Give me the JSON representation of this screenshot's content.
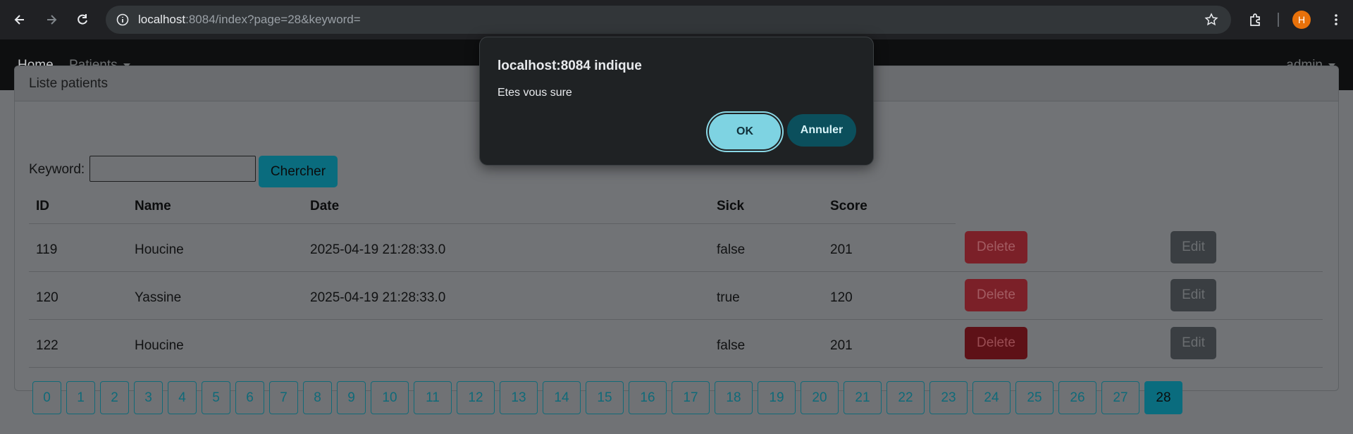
{
  "browser": {
    "url_host": "localhost",
    "url_rest": ":8084/index?page=28&keyword=",
    "profile_initial": "H"
  },
  "navbar": {
    "home": "Home",
    "patients": "Patients",
    "user": "admin"
  },
  "card": {
    "title": "Liste patients",
    "search_label": "Keyword:",
    "search_value": "",
    "search_button": "Chercher"
  },
  "table": {
    "headers": [
      "ID",
      "Name",
      "Date",
      "Sick",
      "Score"
    ],
    "rows": [
      {
        "id": "119",
        "name": "Houcine",
        "date": "2025-04-19 21:28:33.0",
        "sick": "false",
        "score": "201",
        "delete": "Delete",
        "edit": "Edit"
      },
      {
        "id": "120",
        "name": "Yassine",
        "date": "2025-04-19 21:28:33.0",
        "sick": "true",
        "score": "120",
        "delete": "Delete",
        "edit": "Edit"
      },
      {
        "id": "122",
        "name": "Houcine",
        "date": "",
        "sick": "false",
        "score": "201",
        "delete": "Delete",
        "edit": "Edit"
      }
    ]
  },
  "pagination": {
    "pages": [
      "0",
      "1",
      "2",
      "3",
      "4",
      "5",
      "6",
      "7",
      "8",
      "9",
      "10",
      "11",
      "12",
      "13",
      "14",
      "15",
      "16",
      "17",
      "18",
      "19",
      "20",
      "21",
      "22",
      "23",
      "24",
      "25",
      "26",
      "27",
      "28"
    ],
    "active": "28"
  },
  "dialog": {
    "title": "localhost:8084 indique",
    "message": "Etes vous sure",
    "ok": "OK",
    "cancel": "Annuler"
  }
}
